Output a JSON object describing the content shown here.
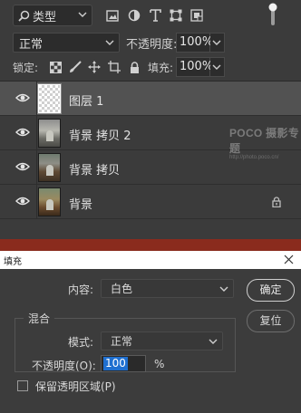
{
  "layers_panel": {
    "filter_label": "类型",
    "blend_mode": "正常",
    "opacity_label": "不透明度:",
    "opacity_value": "100%",
    "lock_label": "锁定:",
    "fill_label": "填充:",
    "fill_value": "100%",
    "layers": [
      {
        "name": "图层 1",
        "visible": true,
        "selected": true,
        "thumbnail": "transparent"
      },
      {
        "name": "背景 拷贝 2",
        "visible": true,
        "selected": false,
        "thumbnail": "photo"
      },
      {
        "name": "背景 拷贝",
        "visible": true,
        "selected": false,
        "thumbnail": "photo"
      },
      {
        "name": "背景",
        "visible": true,
        "selected": false,
        "thumbnail": "photo",
        "locked": true
      }
    ],
    "watermark": {
      "brand": "POCO 摄影专题",
      "url": "http://photo.poco.cn/"
    }
  },
  "fill_dialog": {
    "title": "填充",
    "content_label": "内容:",
    "content_value": "白色",
    "ok_label": "确定",
    "reset_label": "复位",
    "blend_group_title": "混合",
    "mode_label": "模式:",
    "mode_value": "正常",
    "opacity_label": "不透明度(O):",
    "opacity_value": "100",
    "opacity_unit": "%",
    "preserve_label": "保留透明区域(P)",
    "preserve_checked": false
  },
  "colors": {
    "panel_bg": "#3b3b3b",
    "selected_layer_bg": "#525252",
    "accent_selection": "#1f6fd0",
    "red_strip": "#8a2b1d"
  }
}
